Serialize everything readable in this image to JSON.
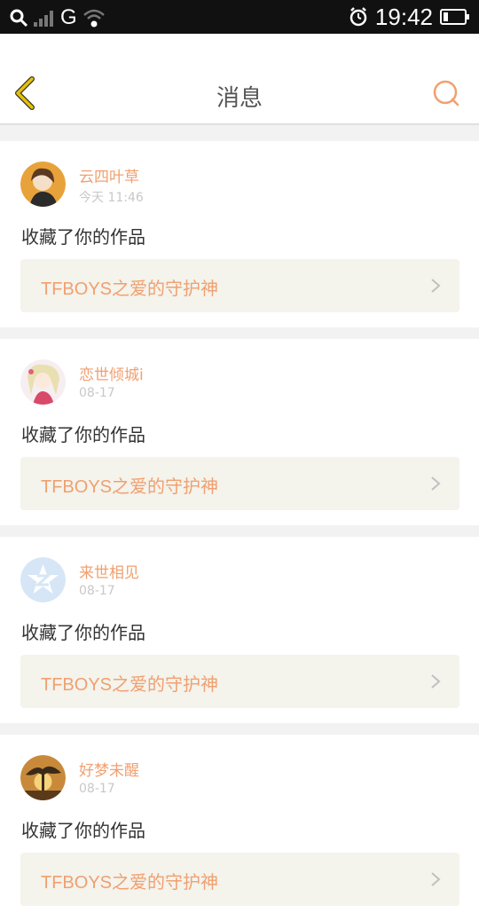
{
  "status_bar": {
    "network": "G",
    "time": "19:42"
  },
  "header": {
    "title": "消息"
  },
  "messages": [
    {
      "user": "云四叶草",
      "time": "今天 11:46",
      "action": "收藏了你的作品",
      "work": "TFBOYS之爱的守护神"
    },
    {
      "user": "恋世倾城i",
      "time": "08-17",
      "action": "收藏了你的作品",
      "work": "TFBOYS之爱的守护神"
    },
    {
      "user": "来世相见",
      "time": "08-17",
      "action": "收藏了你的作品",
      "work": "TFBOYS之爱的守护神"
    },
    {
      "user": "好梦未醒",
      "time": "08-17",
      "action": "收藏了你的作品",
      "work": "TFBOYS之爱的守护神"
    }
  ],
  "colors": {
    "accent": "#f0a070",
    "back_arrow": "#e6c200"
  }
}
